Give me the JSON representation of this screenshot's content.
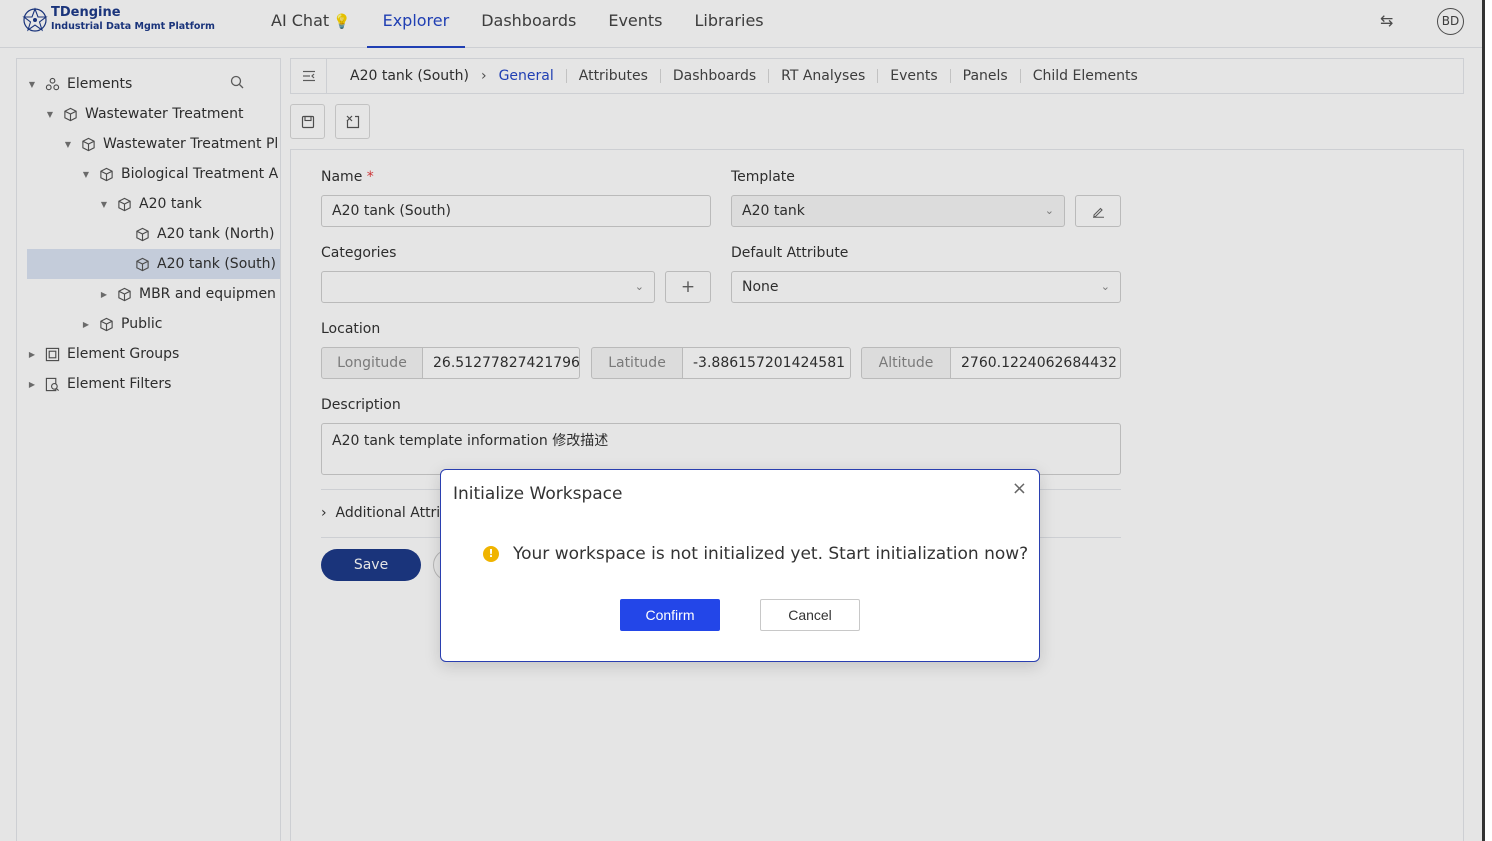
{
  "app": {
    "title": "TDengine",
    "subtitle": "Industrial Data Mgmt Platform",
    "user_initials": "BD"
  },
  "nav": {
    "items": [
      {
        "label": "AI Chat",
        "active": false
      },
      {
        "label": "Explorer",
        "active": true
      },
      {
        "label": "Dashboards",
        "active": false
      },
      {
        "label": "Events",
        "active": false
      },
      {
        "label": "Libraries",
        "active": false
      }
    ]
  },
  "tree": {
    "root": "Elements",
    "items": [
      {
        "label": "Wastewater Treatment",
        "level": 1,
        "expanded": true
      },
      {
        "label": "Wastewater Treatment Pl",
        "level": 2,
        "expanded": true
      },
      {
        "label": "Biological Treatment A",
        "level": 3,
        "expanded": true
      },
      {
        "label": "A20 tank",
        "level": 4,
        "expanded": true
      },
      {
        "label": "A20 tank (North)",
        "level": 5
      },
      {
        "label": "A20 tank (South)",
        "level": 5,
        "selected": true
      },
      {
        "label": "MBR and equipmen",
        "level": 4,
        "expanded": false
      },
      {
        "label": "Public",
        "level": 3,
        "expanded": false
      }
    ],
    "groups": "Element Groups",
    "filters": "Element Filters"
  },
  "breadcrumb": {
    "current": "A20 tank (South)"
  },
  "tabs": [
    "General",
    "Attributes",
    "Dashboards",
    "RT Analyses",
    "Events",
    "Panels",
    "Child Elements"
  ],
  "form": {
    "name_label": "Name",
    "required_mark": "*",
    "name_value": "A20 tank (South)",
    "template_label": "Template",
    "template_value": "A20 tank",
    "categories_label": "Categories",
    "default_attr_label": "Default Attribute",
    "default_attr_value": "None",
    "location_label": "Location",
    "longitude_label": "Longitude",
    "longitude_value": "26.512778274217965",
    "latitude_label": "Latitude",
    "latitude_value": "-3.886157201424581",
    "altitude_label": "Altitude",
    "altitude_value": "2760.1224062684432",
    "description_label": "Description",
    "description_value": "A20 tank template information 修改描述",
    "additional_label": "Additional Attrib",
    "save_label": "Save"
  },
  "modal": {
    "title": "Initialize Workspace",
    "message": "Your workspace is not initialized yet. Start initialization now?",
    "confirm_label": "Confirm",
    "cancel_label": "Cancel"
  },
  "colors": {
    "primary": "#2447c8",
    "confirm": "#2346e8",
    "save": "#1e3a8a",
    "warning": "#f0b400"
  }
}
